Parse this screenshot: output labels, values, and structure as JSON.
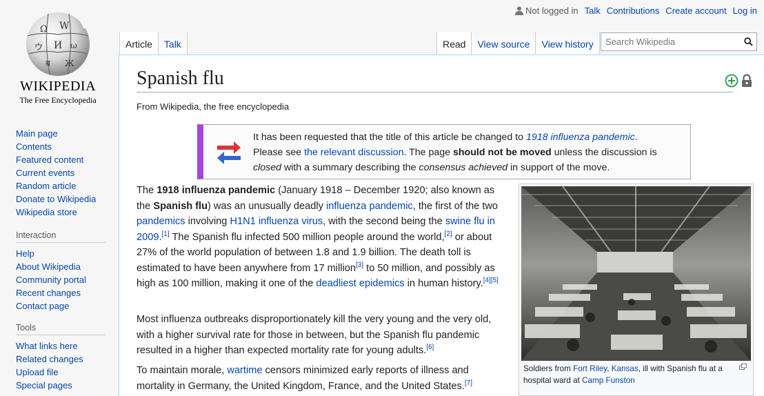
{
  "logo": {
    "wordmark": "Wikipedia",
    "tagline": "The Free Encyclopedia"
  },
  "personal": {
    "not_logged_in": "Not logged in",
    "links": [
      "Talk",
      "Contributions",
      "Create account",
      "Log in"
    ]
  },
  "tabs": {
    "left": [
      "Article",
      "Talk"
    ],
    "right": [
      "Read",
      "View source",
      "View history"
    ]
  },
  "search": {
    "placeholder": "Search Wikipedia"
  },
  "sidebar": {
    "main": [
      "Main page",
      "Contents",
      "Featured content",
      "Current events",
      "Random article",
      "Donate to Wikipedia",
      "Wikipedia store"
    ],
    "interaction": {
      "heading": "Interaction",
      "items": [
        "Help",
        "About Wikipedia",
        "Community portal",
        "Recent changes",
        "Contact page"
      ]
    },
    "tools": {
      "heading": "Tools",
      "items": [
        "What links here",
        "Related changes",
        "Upload file",
        "Special pages"
      ]
    }
  },
  "article": {
    "title": "Spanish flu",
    "tagline": "From Wikipedia, the free encyclopedia",
    "notice": {
      "t1": "It has been requested that the title of this article be changed to ",
      "new_title": "1918 influenza pandemic",
      "t2": ".",
      "t3": "Please see ",
      "link": "the relevant discussion",
      "t4": ". The page ",
      "bold": "should not be moved",
      "t5": " unless the discussion is",
      "closed": "closed",
      "t6": " with a summary describing the ",
      "consensus": "consensus achieved",
      "t7": " in support of the move."
    },
    "p1": {
      "a": "The ",
      "b1": "1918 influenza pandemic",
      "c": " (January 1918 – December 1920; also known as the ",
      "b2": "Spanish flu",
      "d": ") was an unusually deadly ",
      "l1": "influenza pandemic",
      "e": ", the first of the two ",
      "l2": "pandemics",
      "f": " involving ",
      "l3": "H1N1 influenza virus",
      "g": ", with the second being the ",
      "l4": "swine flu in 2009",
      "r1": "[1]",
      "h": " The Spanish flu infected 500 million people around the world,",
      "r2": "[2]",
      "i": " or about 27% of the world population of between 1.8 and 1.9 billion. The death toll is estimated to have been anywhere from 17 million",
      "r3": "[3]",
      "j": " to 50 million, and possibly as high as 100 million, making it one of the ",
      "l5": "deadliest epidemics",
      "k": " in human history.",
      "r4": "[4]",
      "r5": "[5]"
    },
    "p2": {
      "text": "Most influenza outbreaks disproportionately kill the very young and the very old, with a higher survival rate for those in between, but the Spanish flu pandemic resulted in a higher than expected mortality rate for young adults.",
      "r6": "[6]"
    },
    "p3": {
      "a": "To maintain morale, ",
      "l1": "wartime",
      "b": " censors minimized early reports of illness and mortality in Germany, the United Kingdom, France, and the United States.",
      "r7": "[7]"
    },
    "caption": {
      "a": "Soldiers from ",
      "l1": "Fort Riley",
      "b": ", ",
      "l2": "Kansas",
      "c": ", ill with Spanish flu at a hospital ward at ",
      "l3": "Camp Funston"
    }
  }
}
